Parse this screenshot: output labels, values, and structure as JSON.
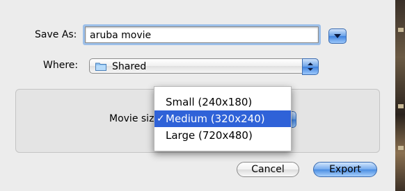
{
  "dialog": {
    "save_as_label": "Save As:",
    "filename": "aruba movie",
    "where_label": "Where:",
    "where_value": "Shared",
    "movie_size_label": "Movie size:"
  },
  "menu": {
    "items": [
      {
        "label": "Small (240x180)",
        "selected": false
      },
      {
        "label": "Medium (320x240)",
        "selected": true
      },
      {
        "label": "Large (720x480)",
        "selected": false
      }
    ],
    "check_glyph": "✓"
  },
  "buttons": {
    "cancel": "Cancel",
    "export": "Export"
  },
  "colors": {
    "accent": "#2f62d8",
    "focus_ring": "#9cbfe9",
    "window_bg": "#ececec"
  },
  "icons": {
    "disclosure": "disclosure-triangle-icon",
    "folder": "folder-icon",
    "popup_arrows": "updown-arrows-icon"
  }
}
